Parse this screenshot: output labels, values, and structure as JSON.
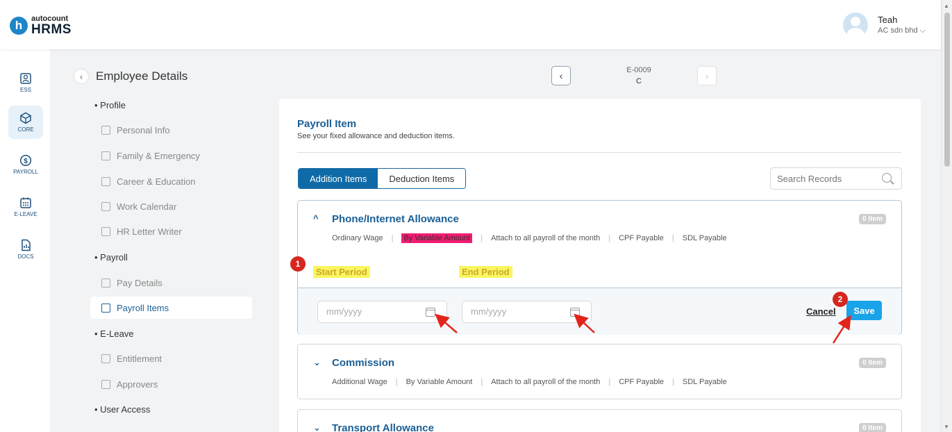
{
  "brand": {
    "top": "autocount",
    "name": "HRMS",
    "mark": "h"
  },
  "user": {
    "name": "Teah",
    "company": "AC sdn bhd"
  },
  "rail": [
    {
      "label": "ESS"
    },
    {
      "label": "CORE"
    },
    {
      "label": "PAYROLL"
    },
    {
      "label": "E-LEAVE"
    },
    {
      "label": "DOCS"
    }
  ],
  "page": {
    "title": "Employee Details"
  },
  "nav": {
    "profile": "Profile",
    "personal": "Personal Info",
    "family": "Family & Emergency",
    "career": "Career & Education",
    "calendar": "Work Calendar",
    "letter": "HR Letter Writer",
    "payroll": "Payroll",
    "pay_details": "Pay Details",
    "payroll_items": "Payroll Items",
    "eleave": "E-Leave",
    "entitlement": "Entitlement",
    "approvers": "Approvers",
    "user_access": "User Access"
  },
  "employee": {
    "id": "E-0009",
    "name": "C"
  },
  "card": {
    "title": "Payroll Item",
    "subtitle": "See your fixed allowance and deduction items.",
    "tab_add": "Addition Items",
    "tab_ded": "Deduction Items",
    "search_placeholder": "Search Records"
  },
  "items": [
    {
      "name": "Phone/Internet Allowance",
      "badge": "0 Item",
      "tags": [
        "Ordinary Wage",
        "By Variable Amount",
        "Attach to all payroll of the month",
        "CPF Payable",
        "SDL Payable"
      ]
    },
    {
      "name": "Commission",
      "badge": "0 Item",
      "tags": [
        "Additional Wage",
        "By Variable Amount",
        "Attach to all payroll of the month",
        "CPF Payable",
        "SDL Payable"
      ]
    },
    {
      "name": "Transport Allowance",
      "badge": "0 Item"
    }
  ],
  "edit": {
    "start_label": "Start Period",
    "end_label": "End Period",
    "start_placeholder": "mm/yyyy",
    "end_placeholder": "mm/yyyy",
    "cancel": "Cancel",
    "save": "Save"
  },
  "markers": [
    "1",
    "2"
  ],
  "colors": {
    "primary": "#0f6aa8",
    "save": "#1aa3e8",
    "highlight_yellow": "#fbf55f",
    "highlight_pink": "#f21c72",
    "marker": "#d7261f"
  }
}
